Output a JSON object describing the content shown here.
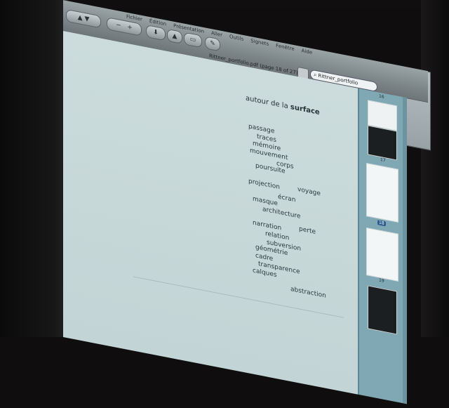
{
  "window": {
    "title": "Rittner_portfolio.pdf (page 18 of 27)",
    "menu": [
      "Fichier",
      "Édition",
      "Présentation",
      "Aller",
      "Outils",
      "Signets",
      "Fenêtre",
      "Aide"
    ]
  },
  "toolbar": {
    "zoom_minus": "−",
    "zoom_plus": "+",
    "search_value": "Rittner_portfolio"
  },
  "document": {
    "heading_prefix": "autour de la ",
    "heading_bold": "surface",
    "words": [
      "passage",
      "traces",
      "mémoire",
      "mouvement",
      "corps",
      "poursuite",
      "projection",
      "voyage",
      "écran",
      "masque",
      "architecture",
      "narration",
      "perte",
      "relation",
      "subversion",
      "géométrie",
      "cadre",
      "transparence",
      "calques",
      "abstraction"
    ]
  },
  "sidebar": {
    "pages": [
      "16",
      "17",
      "18",
      "19"
    ],
    "selected_page": "18"
  },
  "colors": {
    "page_bg": "#c8d9da",
    "sidebar": "#7fa7b4",
    "selected_thumb": "#2b5b8f",
    "text": "#2a3a40"
  }
}
